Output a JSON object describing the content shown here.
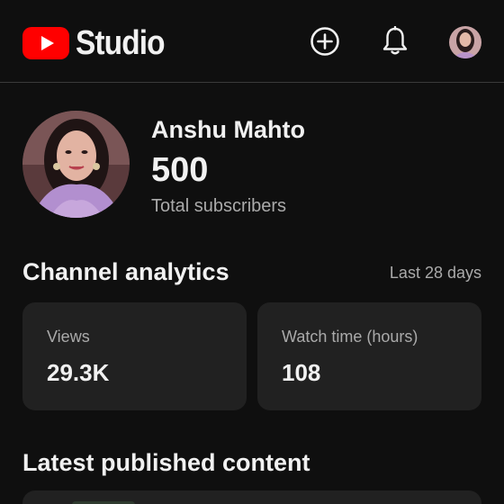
{
  "header": {
    "brand_name": "Studio",
    "create_label": "Create",
    "notifications_label": "Notifications",
    "account_label": "Account"
  },
  "colors": {
    "background": "#0f0f0f",
    "card": "#212121",
    "brand_red": "#ff0000",
    "text_primary": "#f1f1f1",
    "text_secondary": "#aaaaaa"
  },
  "icons": {
    "logo": "youtube-play-logo",
    "create": "plus-circle-icon",
    "notifications": "bell-icon"
  },
  "channel": {
    "name": "Anshu Mahto",
    "subscribers": "500",
    "subscribers_label": "Total subscribers"
  },
  "analytics": {
    "title": "Channel analytics",
    "period": "Last 28 days",
    "cards": [
      {
        "label": "Views",
        "value": "29.3K"
      },
      {
        "label": "Watch time (hours)",
        "value": "108"
      }
    ]
  },
  "latest": {
    "title": "Latest published content"
  }
}
